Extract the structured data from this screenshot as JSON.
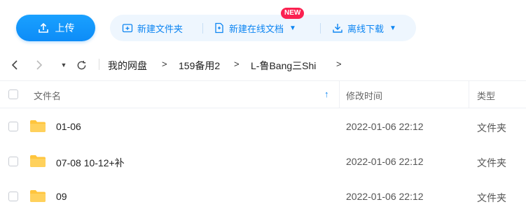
{
  "toolbar": {
    "upload_label": "上传",
    "new_folder_label": "新建文件夹",
    "new_online_doc_label": "新建在线文档",
    "new_badge": "NEW",
    "offline_download_label": "离线下载"
  },
  "breadcrumb": {
    "items": [
      "我的网盘",
      "159备用2",
      "L-鲁Bang三Shi"
    ],
    "separator": ">"
  },
  "table": {
    "headers": {
      "name": "文件名",
      "modified": "修改时间",
      "type": "类型"
    },
    "rows": [
      {
        "name": "01-06",
        "modified": "2022-01-06 22:12",
        "type": "文件夹"
      },
      {
        "name": "07-08 10-12+补",
        "modified": "2022-01-06 22:12",
        "type": "文件夹"
      },
      {
        "name": "09",
        "modified": "2022-01-06 22:12",
        "type": "文件夹"
      }
    ]
  },
  "colors": {
    "accent": "#0d8cf7",
    "action_bar_bg": "#eef6fe",
    "badge": "#fb2150",
    "folder": "#ffc53d"
  }
}
